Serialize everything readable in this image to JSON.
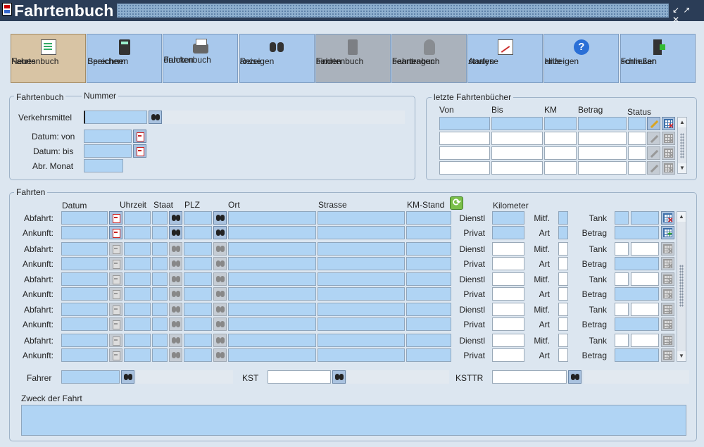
{
  "window": {
    "title": "Fahrtenbuch"
  },
  "toolbar": [
    {
      "id": "neues-fahrtenbuch",
      "line1": "Neues",
      "line2": "Fahrtenbuch",
      "icon": "new-document-icon",
      "state": "active"
    },
    {
      "id": "speichern-berechnen",
      "line1": "Speichern",
      "line2": "Berechnen",
      "icon": "calculator-icon",
      "state": "normal"
    },
    {
      "id": "fahrtenbuch-drucken",
      "line1": "Fahrtenbuch",
      "line2": "drucken",
      "icon": "printer-icon",
      "state": "normal"
    },
    {
      "id": "reise-anzeigen",
      "line1": "Reise",
      "line2": "anzeigen",
      "icon": "binoculars-icon",
      "state": "normal"
    },
    {
      "id": "fahrtenbuch-binden",
      "line1": "Fahrtenbuch",
      "line2": "binden",
      "icon": "binder-icon",
      "state": "disabled"
    },
    {
      "id": "fahrtenbuch-beantragen",
      "line1": "Fahrtenbuch",
      "line2": "beantragen",
      "icon": "hand-icon",
      "state": "disabled"
    },
    {
      "id": "analyse-starten",
      "line1": "Analyse",
      "line2": "starten",
      "icon": "chart-icon",
      "state": "normal"
    },
    {
      "id": "hilfe-anzeigen",
      "line1": "Hilfe",
      "line2": "anzeigen",
      "icon": "help-icon",
      "state": "normal"
    },
    {
      "id": "formular-schliessen",
      "line1": "Formular",
      "line2": "schließen",
      "icon": "exit-door-icon",
      "state": "normal"
    }
  ],
  "fahrtenbuch": {
    "group_label": "Fahrtenbuch",
    "nummer_label": "Nummer",
    "verkehrsmittel_label": "Verkehrsmittel",
    "datum_von_label": "Datum: von",
    "datum_bis_label": "Datum: bis",
    "abr_monat_label": "Abr. Monat"
  },
  "letzte": {
    "group_label": "letzte Fahrtenbücher",
    "col_von": "Von",
    "col_bis": "Bis",
    "col_km": "KM",
    "col_betrag": "Betrag",
    "col_status": "Status"
  },
  "fahrten": {
    "group_label": "Fahrten",
    "col_datum": "Datum",
    "col_uhrzeit": "Uhrzeit",
    "col_staat": "Staat",
    "col_plz": "PLZ",
    "col_ort": "Ort",
    "col_strasse": "Strasse",
    "col_kmstand": "KM-Stand",
    "col_kilometer": "Kilometer",
    "abfahrt": "Abfahrt:",
    "ankunft": "Ankunft:",
    "dienstl": "Dienstl",
    "privat": "Privat",
    "mitf": "Mitf.",
    "art": "Art",
    "tank": "Tank",
    "betrag": "Betrag"
  },
  "bottom": {
    "fahrer_label": "Fahrer",
    "kst_label": "KST",
    "ksttr_label": "KSTTR",
    "zweck_label": "Zweck der Fahrt"
  }
}
